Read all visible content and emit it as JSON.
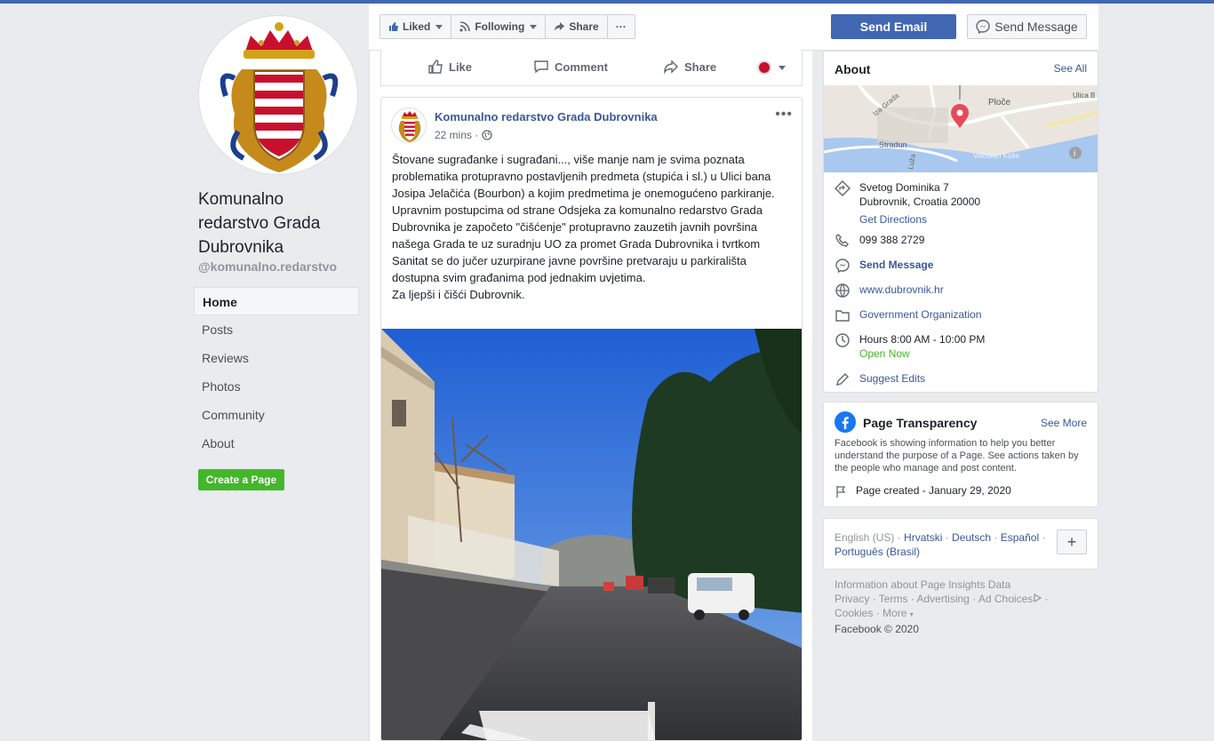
{
  "page": {
    "name": "Komunalno redarstvo Grada Dubrovnika",
    "handle": "@komunalno.redarstvo"
  },
  "nav": {
    "items": [
      {
        "label": "Home"
      },
      {
        "label": "Posts"
      },
      {
        "label": "Reviews"
      },
      {
        "label": "Photos"
      },
      {
        "label": "Community"
      },
      {
        "label": "About"
      }
    ],
    "create_page": "Create a Page"
  },
  "toolbar": {
    "liked": "Liked",
    "following": "Following",
    "share": "Share",
    "more": "···",
    "send_email": "Send Email",
    "send_message": "Send Message"
  },
  "prev_post_actions": {
    "like": "Like",
    "comment": "Comment",
    "share": "Share"
  },
  "post": {
    "author": "Komunalno redarstvo Grada Dubrovnika",
    "time": "22 mins ·",
    "more": "•••",
    "text": "Štovane sugrađanke i sugrađani..., više manje nam je svima poznata problematika protupravno postavljenih predmeta (stupića i sl.) u Ulici bana Josipa Jelačića (Bourbon) a kojim predmetima je onemogućeno parkiranje. Upravnim postupcima od strane Odsjeka za komunalno redarstvo Grada Dubrovnika je započeto \"čišćenje\" protupravno zauzetih javnih površina našega Grada te uz suradnju UO za promet Grada Dubrovnika i tvrtkom Sanitat se do jučer uzurpirane javne površine pretvaraju u parkirališta dostupna svim građanima pod jednakim uvjetima.",
    "text2": "Za ljepši i čišći Dubrovnik."
  },
  "about": {
    "title": "About",
    "see_all": "See All",
    "map_labels": {
      "street1": "Iza Grada",
      "street2": "Stradun",
      "street3": "Ulica B",
      "place1": "Ploče",
      "place2": "Valobran Koše",
      "street4": "Luža"
    },
    "address_line1": "Svetog Dominika 7",
    "address_line2": "Dubrovnik, Croatia 20000",
    "directions": "Get Directions",
    "phone": "099 388 2729",
    "send_message": "Send Message",
    "website": "www.dubrovnik.hr",
    "category": "Government Organization",
    "hours": "Hours 8:00 AM - 10:00 PM",
    "open_now": "Open Now",
    "suggest": "Suggest Edits"
  },
  "transparency": {
    "title": "Page Transparency",
    "see_more": "See More",
    "text": "Facebook is showing information to help you better understand the purpose of a Page. See actions taken by the people who manage and post content.",
    "created": "Page created - January 29, 2020"
  },
  "languages": {
    "current": "English (US)",
    "others": [
      "Hrvatski",
      "Deutsch",
      "Español",
      "Português (Brasil)"
    ],
    "plus": "+"
  },
  "footer": {
    "insights": "Information about Page Insights Data",
    "privacy": "Privacy",
    "terms": "Terms",
    "advertising": "Advertising",
    "adchoices": "Ad Choices",
    "cookies": "Cookies",
    "more": "More",
    "copyright": "Facebook © 2020"
  },
  "colors": {
    "brand": "#4267b2",
    "link": "#385898",
    "green": "#42b72a",
    "background": "#e9ebee"
  }
}
